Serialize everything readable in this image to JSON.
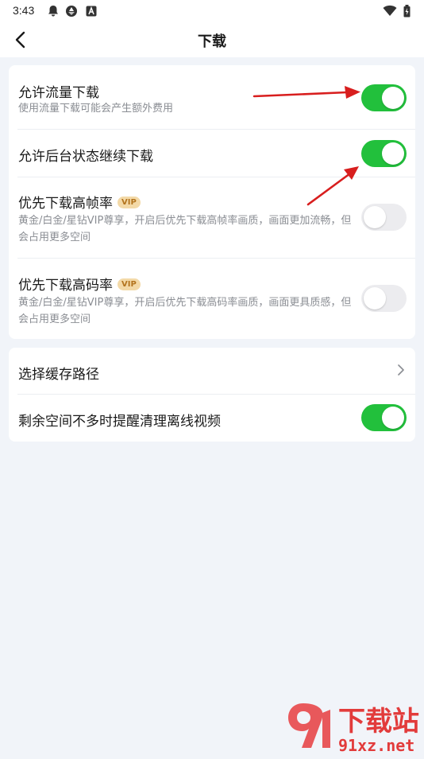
{
  "status_bar": {
    "time": "3:43",
    "left_icons": [
      "notification-bell-icon",
      "camera-shutter-icon",
      "text-a-icon"
    ],
    "right_icons": [
      "wifi-icon",
      "battery-icon"
    ]
  },
  "header": {
    "title": "下载",
    "back_icon": "back-arrow-icon"
  },
  "settings_group_1": [
    {
      "title": "允许流量下载",
      "subtitle": "使用流量下载可能会产生额外费用",
      "toggle_on": true
    },
    {
      "title": "允许后台状态继续下载",
      "toggle_on": true
    },
    {
      "title": "优先下载高帧率",
      "badge": "VIP",
      "subtitle": "黄金/白金/星钻VIP尊享，开启后优先下载高帧率画质，画面更加流畅，但会占用更多空间",
      "toggle_on": false
    },
    {
      "title": "优先下载高码率",
      "badge": "VIP",
      "subtitle": "黄金/白金/星钻VIP尊享，开启后优先下载高码率画质，画面更具质感，但会占用更多空间",
      "toggle_on": false
    }
  ],
  "settings_group_2": [
    {
      "title": "选择缓存路径",
      "icon": "chevron-right-icon"
    },
    {
      "title": "剩余空间不多时提醒清理离线视频",
      "toggle_on": true
    }
  ],
  "colors": {
    "toggle_on": "#22c03c",
    "toggle_off": "#ececef",
    "background": "#f1f4f9",
    "annotation_arrow": "#d81e1e",
    "vip_badge_bg": "#f3d9a7",
    "vip_badge_text": "#b3741e"
  },
  "watermark": {
    "brand": "下载站",
    "url": "91xz.net"
  }
}
